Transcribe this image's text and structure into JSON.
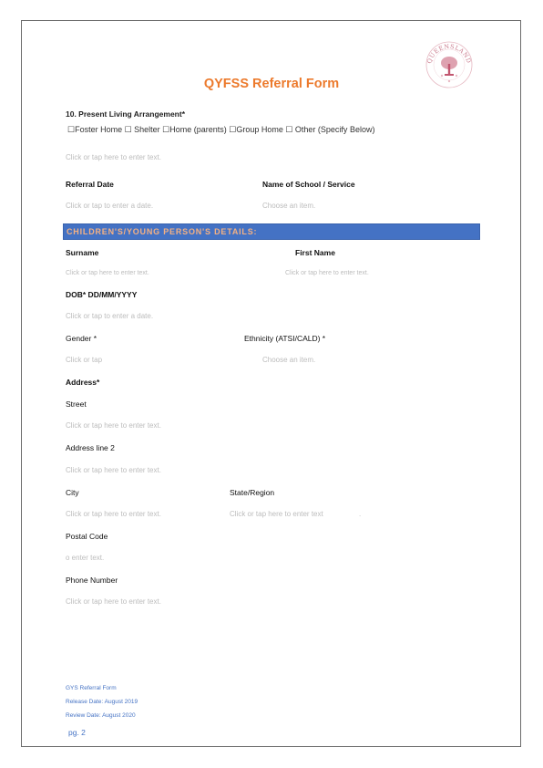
{
  "logo_text": "QUEENSLAND",
  "title": "QYFSS Referral Form",
  "question": {
    "label": "10.    Present Living Arrangement*",
    "options": "☐Foster Home ☐ Shelter  ☐Home (parents) ☐Group Home   ☐ Other (Specify Below)",
    "placeholder": "Click or tap here to enter text."
  },
  "referral": {
    "date_label": "Referral Date",
    "date_placeholder": "Click or tap to enter a date.",
    "school_label": "Name of School / Service",
    "school_placeholder": "Choose an item."
  },
  "section_title": "CHILDREN'S/YOUNG PERSON'S DETAILS:",
  "details": {
    "surname_label": "Surname",
    "surname_placeholder": "Click or tap here to enter text.",
    "firstname_label": "First Name",
    "firstname_placeholder": "Click or tap here to enter text.",
    "dob_label": "DOB*     DD/MM/YYYY",
    "dob_placeholder": "Click or tap to enter a date.",
    "gender_label": "Gender *",
    "gender_placeholder": "Click or tap",
    "ethnicity_label": "Ethnicity (ATSI/CALD) *",
    "ethnicity_placeholder": "Choose an item.",
    "address_label": "Address*",
    "street_label": "Street",
    "street_placeholder": "Click or tap here to enter text.",
    "address2_label": "Address line 2",
    "address2_placeholder": "Click or tap here to enter text.",
    "city_label": "City",
    "city_placeholder": "Click or tap here to enter text.",
    "state_label": "State/Region",
    "state_placeholder": "Click or tap here to enter text",
    "state_suffix": ".",
    "postal_label": "Postal Code",
    "postal_placeholder": "o enter text.",
    "phone_label": "Phone Number",
    "phone_placeholder": "Click or tap here to enter text."
  },
  "footer": {
    "form_name": "GYS Referral Form",
    "release": "Release Date: August 2019",
    "review": "Review Date: August 2020",
    "page": "pg. 2"
  }
}
